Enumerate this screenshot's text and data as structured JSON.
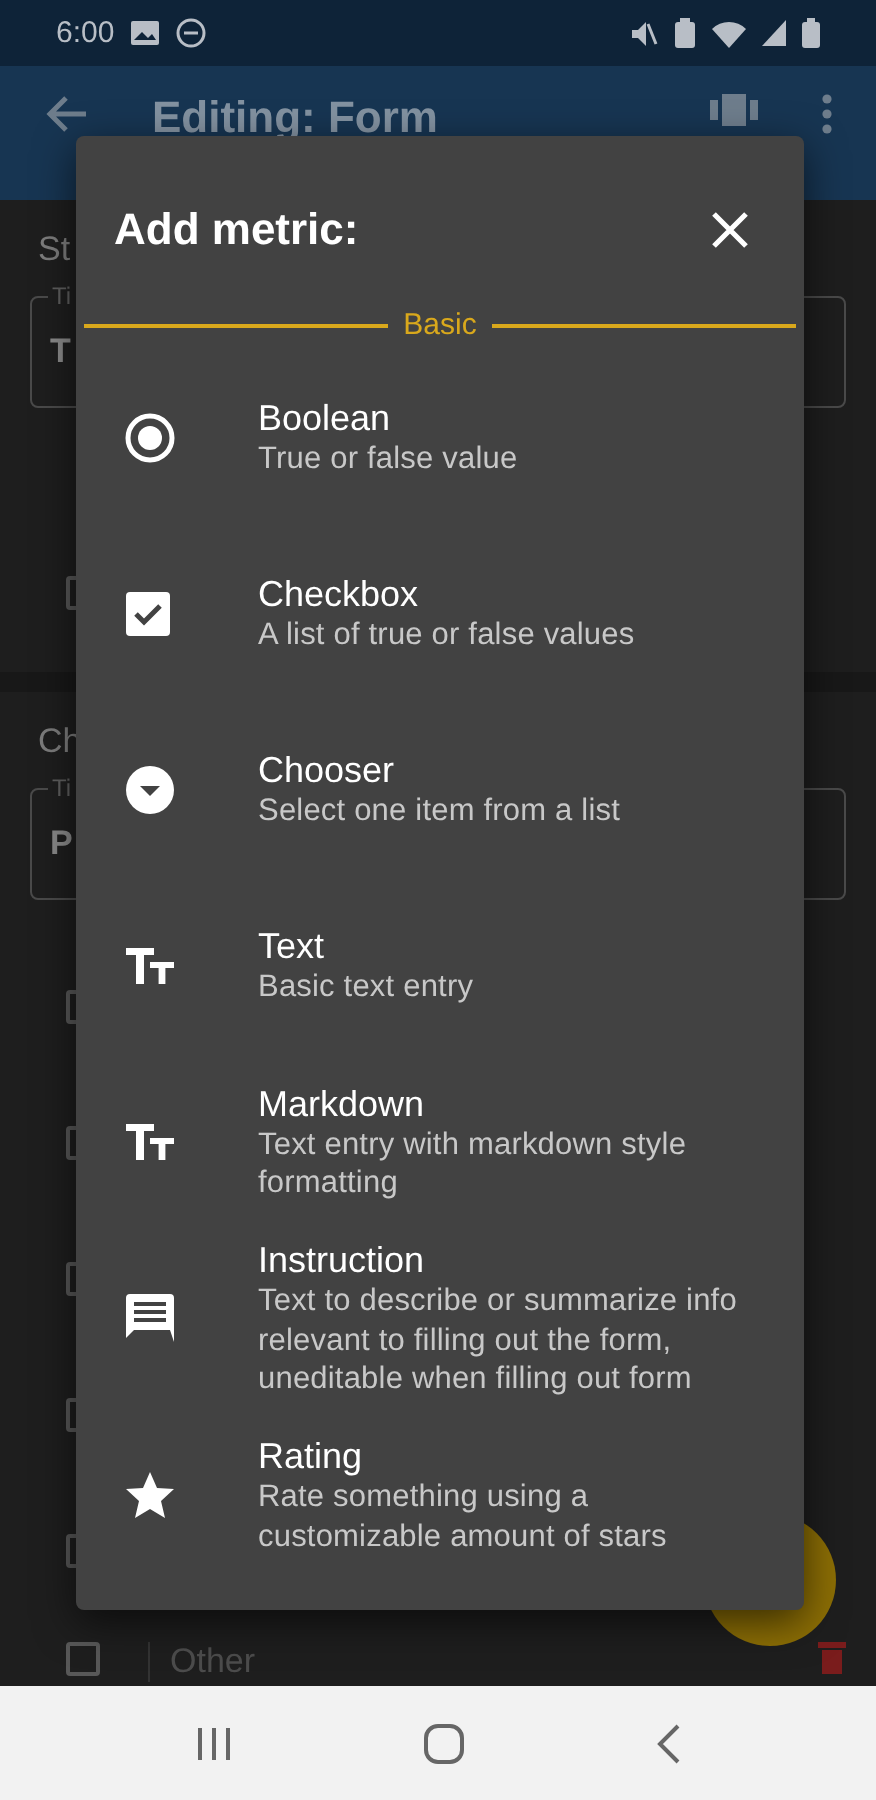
{
  "status_bar": {
    "time": "6:00"
  },
  "app_bar": {
    "title": "Editing: Form"
  },
  "form": {
    "sections": [
      {
        "title": "St",
        "field": {
          "label": "Ti",
          "value": "T"
        },
        "options": [
          {
            "checked": false
          }
        ]
      },
      {
        "title": "Ch",
        "field": {
          "label": "Ti",
          "value": "P"
        },
        "options": [
          {
            "checked": false
          },
          {
            "checked": false
          },
          {
            "checked": false
          },
          {
            "checked": false
          },
          {
            "checked": false
          }
        ],
        "new_option": {
          "placeholder": "Other",
          "checked": false
        }
      }
    ]
  },
  "dialog": {
    "title": "Add metric:",
    "section": "Basic",
    "items": [
      {
        "kind": "boolean",
        "title": "Boolean",
        "description": "True or false value"
      },
      {
        "kind": "checkbox",
        "title": "Checkbox",
        "description": "A list of true or false values"
      },
      {
        "kind": "chooser",
        "title": "Chooser",
        "description": "Select one item from a list"
      },
      {
        "kind": "text",
        "title": "Text",
        "description": "Basic text entry"
      },
      {
        "kind": "text",
        "title": "Markdown",
        "description": "Text entry with markdown style formatting"
      },
      {
        "kind": "instruction",
        "title": "Instruction",
        "description": "Text to describe or summarize info relevant to filling out the form, uneditable when filling out form"
      },
      {
        "kind": "rating",
        "title": "Rating",
        "description": "Rate something using a customizable amount of stars"
      }
    ]
  }
}
